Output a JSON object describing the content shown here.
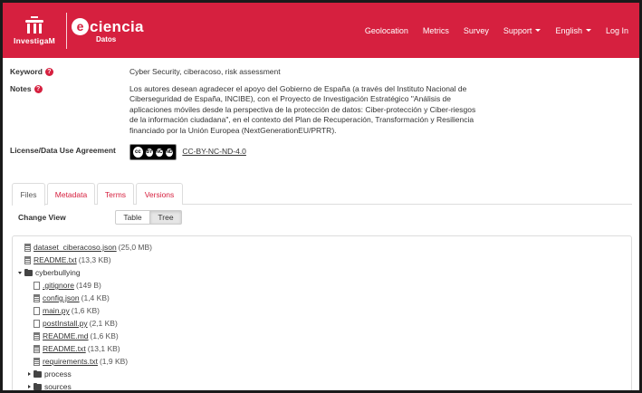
{
  "brand": {
    "investigam": "InvestigaM",
    "eciencia_letter": "e",
    "eciencia_word": "ciencia",
    "eciencia_sub": "Datos"
  },
  "nav": {
    "items": [
      {
        "label": "Geolocation"
      },
      {
        "label": "Metrics"
      },
      {
        "label": "Survey"
      },
      {
        "label": "Support",
        "dropdown": true
      },
      {
        "label": "English",
        "dropdown": true
      },
      {
        "label": "Log In"
      }
    ]
  },
  "help_glyph": "?",
  "keyword": {
    "label": "Keyword",
    "value": "Cyber Security, ciberacoso, risk assessment"
  },
  "notes": {
    "label": "Notes",
    "lines": [
      "Los autores desean agradecer el apoyo del Gobierno de España (a través del Instituto Nacional de",
      "Ciberseguridad de España, INCIBE), con el Proyecto de Investigación Estratégico \"Análisis de",
      "aplicaciones móviles desde la perspectiva de la protección de datos: Ciber-protección y Ciber-riesgos",
      "de la información ciudadana\", en el contexto del Plan de Recuperación, Transformación y Resiliencia",
      "financiado por la Unión Europea (NextGenerationEU/PRTR)."
    ]
  },
  "license": {
    "label": "License/Data Use Agreement",
    "badge_logo": "cc",
    "badge_symbols": [
      "BY",
      "NC",
      "ND"
    ],
    "link": "CC-BY-NC-ND-4.0"
  },
  "tabs": [
    {
      "label": "Files",
      "active": true
    },
    {
      "label": "Metadata",
      "active": false
    },
    {
      "label": "Terms",
      "active": false
    },
    {
      "label": "Versions",
      "active": false
    }
  ],
  "change_view": {
    "label": "Change View",
    "options": [
      "Table",
      "Tree"
    ],
    "selected": "Tree"
  },
  "tree": {
    "nodes": [
      {
        "name": "dataset_ciberacoso.json",
        "size": "(25,0 MB)"
      },
      {
        "name": "README.txt",
        "size": "(13,3 KB)"
      },
      {
        "name": "cyberbullying",
        "folder": true,
        "expanded": true
      },
      {
        "name": ".gitignore",
        "size": "(149 B)"
      },
      {
        "name": "config.json",
        "size": "(1,4 KB)"
      },
      {
        "name": "main.py",
        "size": "(1,6 KB)"
      },
      {
        "name": "postInstall.py",
        "size": "(2,1 KB)"
      },
      {
        "name": "README.md",
        "size": "(1,6 KB)"
      },
      {
        "name": "README.txt",
        "size": "(13,1 KB)"
      },
      {
        "name": "requirements.txt",
        "size": "(1,9 KB)"
      },
      {
        "name": "process",
        "folder": true,
        "expanded": false
      },
      {
        "name": "sources",
        "folder": true,
        "expanded": false
      }
    ]
  }
}
